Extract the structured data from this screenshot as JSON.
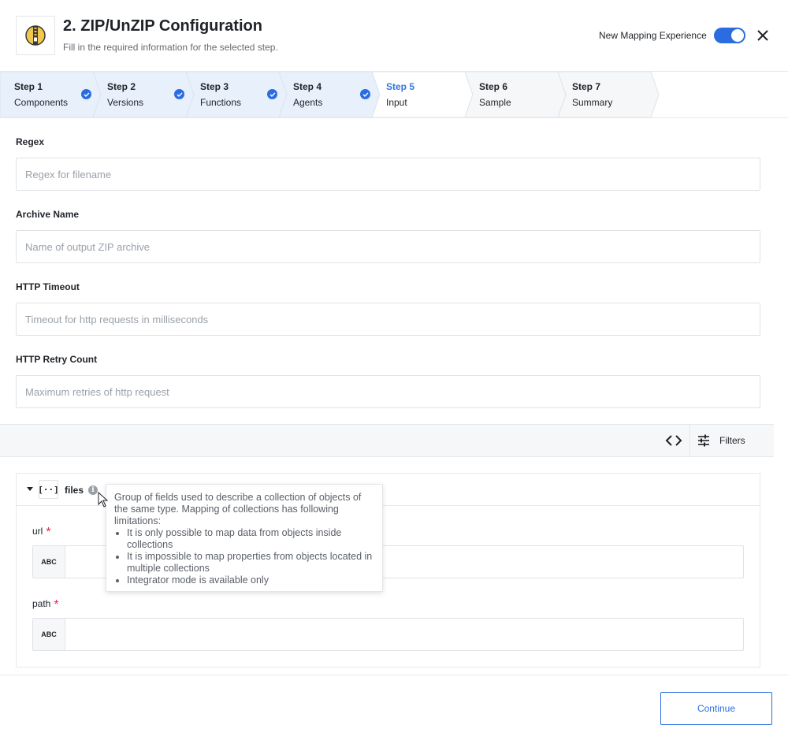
{
  "header": {
    "title": "2. ZIP/UnZIP Configuration",
    "subtitle": "Fill in the required information for the selected step.",
    "logo_icon": "zip-file-icon",
    "toggle_label": "New Mapping Experience",
    "toggle_on": true,
    "close_icon": "close-icon"
  },
  "steps": [
    {
      "num": "Step 1",
      "label": "Components",
      "state": "done"
    },
    {
      "num": "Step 2",
      "label": "Versions",
      "state": "done"
    },
    {
      "num": "Step 3",
      "label": "Functions",
      "state": "done"
    },
    {
      "num": "Step 4",
      "label": "Agents",
      "state": "done"
    },
    {
      "num": "Step 5",
      "label": "Input",
      "state": "active"
    },
    {
      "num": "Step 6",
      "label": "Sample",
      "state": "pending"
    },
    {
      "num": "Step 7",
      "label": "Summary",
      "state": "pending"
    }
  ],
  "form": {
    "regex": {
      "label": "Regex",
      "placeholder": "Regex for filename",
      "value": ""
    },
    "archive_name": {
      "label": "Archive Name",
      "placeholder": "Name of output ZIP archive",
      "value": ""
    },
    "http_timeout": {
      "label": "HTTP Timeout",
      "placeholder": "Timeout for http requests in milliseconds",
      "value": ""
    },
    "http_retry": {
      "label": "HTTP Retry Count",
      "placeholder": "Maximum retries of http request",
      "value": ""
    }
  },
  "toolbar": {
    "code_icon": "code-brackets-icon",
    "filters_icon": "sliders-icon",
    "filters_label": "Filters"
  },
  "files": {
    "label": "files",
    "type_icon": "[··]",
    "fields": [
      {
        "label": "url",
        "required": "*",
        "type": "ABC"
      },
      {
        "label": "path",
        "required": "*",
        "type": "ABC"
      }
    ]
  },
  "tooltip": {
    "intro": "Group of fields used to describe a collection of objects of the same type. Mapping of collections has following limitations:",
    "items": [
      "It is only possible to map data from objects inside collections",
      "It is impossible to map properties from objects located in multiple collections",
      "Integrator mode is available only"
    ]
  },
  "footer": {
    "continue_label": "Continue"
  },
  "colors": {
    "accent": "#2b6de0",
    "active_step": "#3377e0",
    "done_step_bg": "#e8f0fb",
    "required": "#e0294b"
  }
}
